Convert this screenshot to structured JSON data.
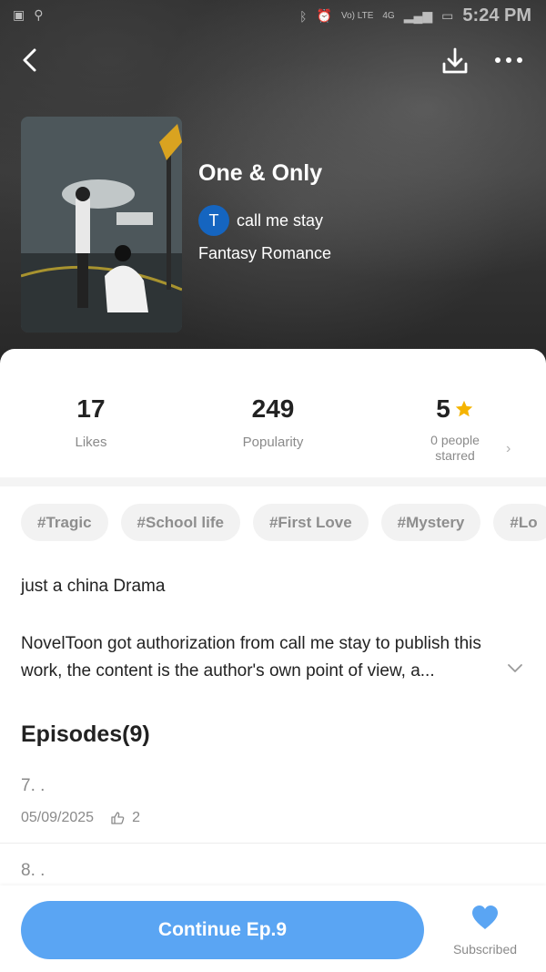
{
  "status_bar": {
    "time": "5:24 PM",
    "network": "4G",
    "volte": "Vo) LTE"
  },
  "book": {
    "title": "One & Only",
    "author_initial": "T",
    "author": "call me stay",
    "genre": "Fantasy Romance"
  },
  "stats": {
    "likes_value": "17",
    "likes_label": "Likes",
    "popularity_value": "249",
    "popularity_label": "Popularity",
    "rating_value": "5",
    "rating_label": "0 people starred"
  },
  "tags": [
    "#Tragic",
    "#School life",
    "#First Love",
    "#Mystery",
    "#Lo"
  ],
  "description": {
    "short": "just a china Drama",
    "long": "NovelToon got authorization from call me stay to publish this work, the content is the author's own point of view, a..."
  },
  "episodes": {
    "header": "Episodes(9)",
    "items": [
      {
        "title": "7. .",
        "date": "05/09/2025",
        "likes": "2"
      },
      {
        "title": "8. ."
      }
    ]
  },
  "actions": {
    "continue_label": "Continue Ep.9",
    "subscribed_label": "Subscribed"
  },
  "colors": {
    "accent": "#5aa5f3",
    "author_avatar": "#1565c0",
    "star": "#f5b400"
  }
}
